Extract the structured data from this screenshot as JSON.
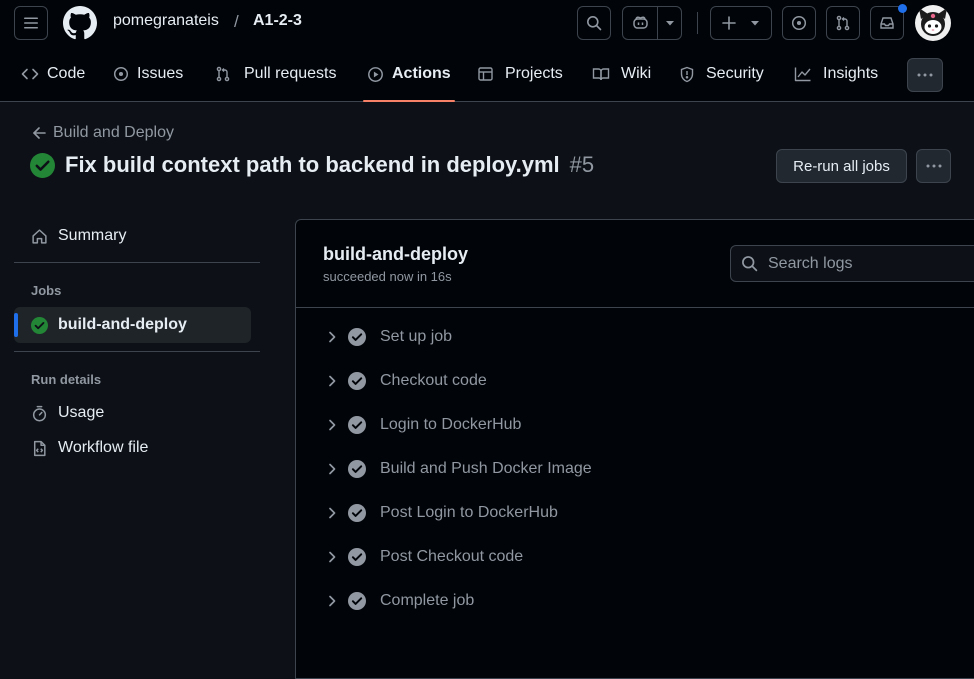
{
  "header": {
    "owner": "pomegranateis",
    "separator": "/",
    "repo": "A1-2-3"
  },
  "repo_nav": {
    "tabs": [
      {
        "label": "Code",
        "icon": "code-icon"
      },
      {
        "label": "Issues",
        "icon": "issue-icon"
      },
      {
        "label": "Pull requests",
        "icon": "pull-request-icon"
      },
      {
        "label": "Actions",
        "icon": "play-icon",
        "active": true
      },
      {
        "label": "Projects",
        "icon": "table-icon"
      },
      {
        "label": "Wiki",
        "icon": "book-icon"
      },
      {
        "label": "Security",
        "icon": "shield-icon"
      },
      {
        "label": "Insights",
        "icon": "graph-icon"
      }
    ]
  },
  "run": {
    "back_label": "Build and Deploy",
    "title": "Fix build context path to backend in deploy.yml",
    "number": "#5",
    "rerun_label": "Re-run all jobs"
  },
  "sidebar": {
    "summary_label": "Summary",
    "jobs_heading": "Jobs",
    "job_label": "build-and-deploy",
    "run_details_heading": "Run details",
    "usage_label": "Usage",
    "workflow_label": "Workflow file"
  },
  "job": {
    "name": "build-and-deploy",
    "status": "succeeded now in 16s",
    "search_placeholder": "Search logs",
    "steps": [
      {
        "label": "Set up job"
      },
      {
        "label": "Checkout code"
      },
      {
        "label": "Login to DockerHub"
      },
      {
        "label": "Build and Push Docker Image"
      },
      {
        "label": "Post Login to DockerHub"
      },
      {
        "label": "Post Checkout code"
      },
      {
        "label": "Complete job"
      }
    ]
  },
  "colors": {
    "success": "#238636",
    "step_check": "#9198a1",
    "active_underline": "#f78166",
    "notification_dot": "#1f6feb"
  }
}
